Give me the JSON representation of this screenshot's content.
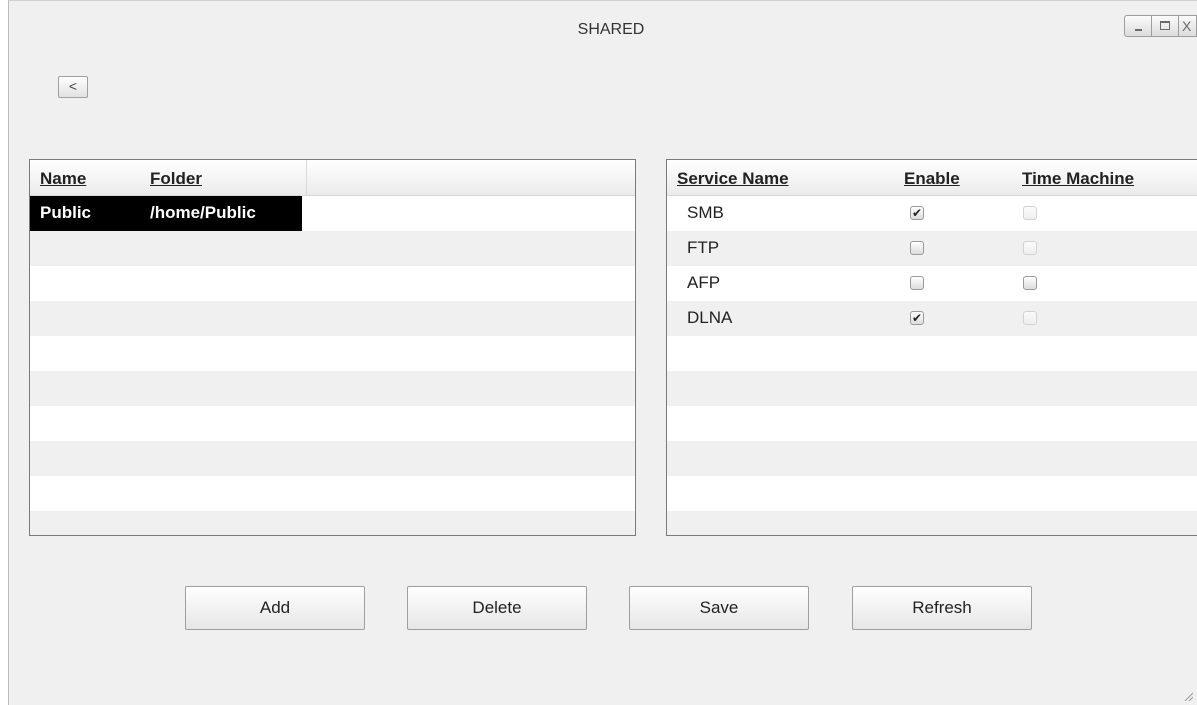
{
  "window": {
    "title": "SHARED",
    "controls": {
      "minimize_icon": "minimize-icon",
      "maximize_icon": "maximize-icon",
      "close_glyph": "X"
    }
  },
  "toolbar": {
    "back_label": "<"
  },
  "shares_table": {
    "headers": [
      "Name",
      "Folder"
    ],
    "rows": [
      {
        "name": "Public",
        "folder": "/home/Public",
        "selected": true
      }
    ]
  },
  "services_table": {
    "headers": [
      "Service Name",
      "Enable",
      "Time Machine"
    ],
    "rows": [
      {
        "service": "SMB",
        "enable": true,
        "time_machine": false,
        "time_machine_disabled": true
      },
      {
        "service": "FTP",
        "enable": false,
        "time_machine": false,
        "time_machine_disabled": true
      },
      {
        "service": "AFP",
        "enable": false,
        "time_machine": false,
        "time_machine_disabled": false
      },
      {
        "service": "DLNA",
        "enable": true,
        "time_machine": false,
        "time_machine_disabled": true
      }
    ]
  },
  "buttons": {
    "add": "Add",
    "delete": "Delete",
    "save": "Save",
    "refresh": "Refresh"
  },
  "colors": {
    "window_bg": "#f0f0f0",
    "selection_bg": "#000000",
    "selection_text": "#ffffff"
  }
}
